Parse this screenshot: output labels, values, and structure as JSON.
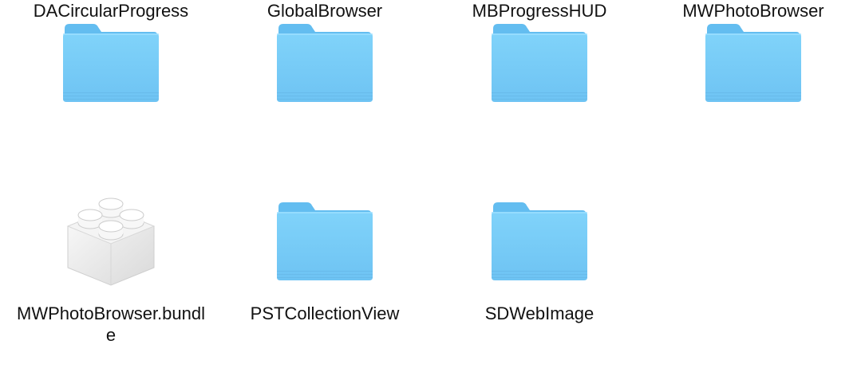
{
  "items": [
    {
      "name": "DACircularProgress",
      "icon": "folder-icon"
    },
    {
      "name": "GlobalBrowser",
      "icon": "folder-icon"
    },
    {
      "name": "MBProgressHUD",
      "icon": "folder-icon"
    },
    {
      "name": "MWPhotoBrowser",
      "icon": "folder-icon"
    },
    {
      "name": "MWPhotoBrowser.bundle",
      "icon": "bundle-icon"
    },
    {
      "name": "PSTCollectionView",
      "icon": "folder-icon"
    },
    {
      "name": "SDWebImage",
      "icon": "folder-icon"
    }
  ],
  "colors": {
    "folder_body": "#74CBF7",
    "folder_tab": "#5EB8EE",
    "bundle_body": "#EDEDED"
  }
}
